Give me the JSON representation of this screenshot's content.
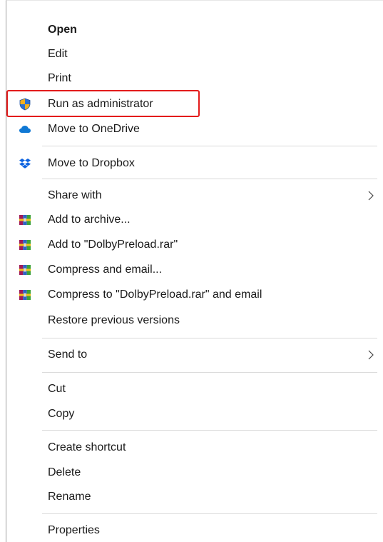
{
  "context_menu": {
    "items": [
      {
        "label": "Open",
        "icon": null,
        "submenu": false
      },
      {
        "label": "Edit",
        "icon": null,
        "submenu": false
      },
      {
        "label": "Print",
        "icon": null,
        "submenu": false
      },
      {
        "label": "Run as administrator",
        "icon": "uac-shield-icon",
        "submenu": false
      },
      {
        "label": "Move to OneDrive",
        "icon": "onedrive-cloud-icon",
        "submenu": false
      },
      {
        "label": "Move to Dropbox",
        "icon": "dropbox-icon",
        "submenu": false
      },
      {
        "label": "Share with",
        "icon": null,
        "submenu": true
      },
      {
        "label": "Add to archive...",
        "icon": "winrar-icon",
        "submenu": false
      },
      {
        "label": "Add to \"DolbyPreload.rar\"",
        "icon": "winrar-icon",
        "submenu": false
      },
      {
        "label": "Compress and email...",
        "icon": "winrar-icon",
        "submenu": false
      },
      {
        "label": "Compress to \"DolbyPreload.rar\" and email",
        "icon": "winrar-icon",
        "submenu": false
      },
      {
        "label": "Restore previous versions",
        "icon": null,
        "submenu": false
      },
      {
        "label": "Send to",
        "icon": null,
        "submenu": true
      },
      {
        "label": "Cut",
        "icon": null,
        "submenu": false
      },
      {
        "label": "Copy",
        "icon": null,
        "submenu": false
      },
      {
        "label": "Create shortcut",
        "icon": null,
        "submenu": false
      },
      {
        "label": "Delete",
        "icon": null,
        "submenu": false
      },
      {
        "label": "Rename",
        "icon": null,
        "submenu": false
      },
      {
        "label": "Properties",
        "icon": null,
        "submenu": false
      }
    ],
    "highlighted_item": "Run as administrator",
    "highlight_color": "#e31b1b"
  }
}
